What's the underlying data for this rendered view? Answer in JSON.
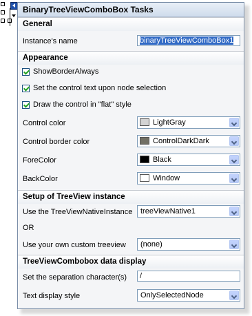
{
  "panel": {
    "title": "BinaryTreeViewComboBox Tasks"
  },
  "general": {
    "heading": "General",
    "instance_name_label": "Instance's name",
    "instance_name_value": "binaryTreeViewComboBox1"
  },
  "appearance": {
    "heading": "Appearance",
    "show_border_always": {
      "label": "ShowBorderAlways",
      "checked": true
    },
    "set_text_on_select": {
      "label": "Set the control text upon node selection",
      "checked": true
    },
    "flat_style": {
      "label": "Draw the control in \"flat\" style",
      "checked": true
    },
    "control_color": {
      "label": "Control color",
      "value": "LightGray",
      "swatch": "#d3d3d3"
    },
    "control_border_color": {
      "label": "Control border color",
      "value": "ControlDarkDark",
      "swatch": "#716f64"
    },
    "fore_color": {
      "label": "ForeColor",
      "value": "Black",
      "swatch": "#000000"
    },
    "back_color": {
      "label": "BackColor",
      "value": "Window",
      "swatch": "#ffffff"
    }
  },
  "treeview_setup": {
    "heading": "Setup of TreeView instance",
    "native_label": "Use the TreeViewNativeInstance",
    "native_value": "treeViewNative1",
    "or_label": "OR",
    "custom_label": "Use your own custom treeview",
    "custom_value": "(none)"
  },
  "data_display": {
    "heading": "TreeViewCombobox data display",
    "separator_label": "Set the separation character(s)",
    "separator_value": "/",
    "display_style_label": "Text display style",
    "display_style_value": "OnlySelectedNode"
  }
}
